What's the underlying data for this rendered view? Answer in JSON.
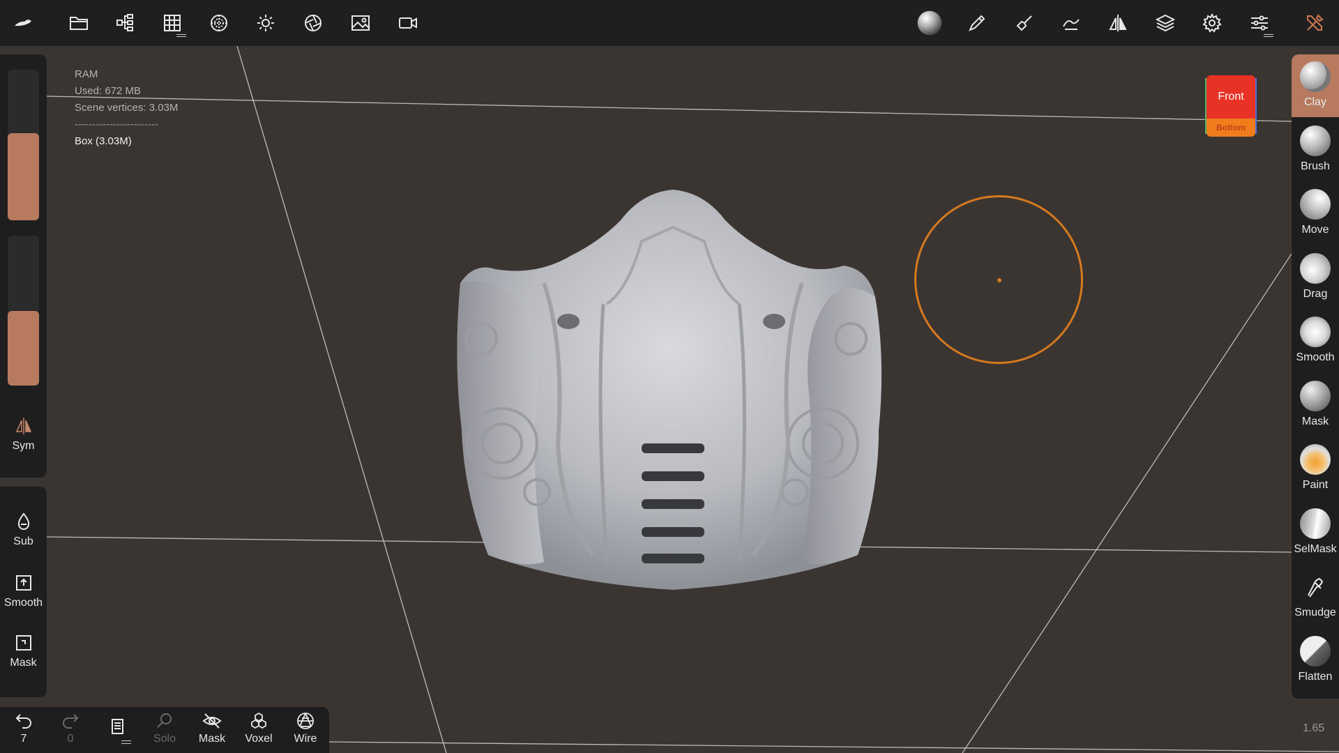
{
  "info": {
    "ram_label": "RAM",
    "used": "Used: 672 MB",
    "scene_vertices": "Scene vertices: 3.03M",
    "separator": "------------------------",
    "object": "Box (3.03M)"
  },
  "viewcube": {
    "front": "Front",
    "bottom": "Bottom"
  },
  "left_panel": {
    "sym_label": "Sym",
    "slider1_level": 0.58,
    "slider2_level": 0.5,
    "sub_label": "Sub",
    "smooth_label": "Smooth",
    "mask_label": "Mask"
  },
  "bottom_bar": {
    "undo_count": "7",
    "redo_count": "0",
    "solo_label": "Solo",
    "mask_label": "Mask",
    "voxel_label": "Voxel",
    "wire_label": "Wire"
  },
  "tools": {
    "clay": "Clay",
    "brush": "Brush",
    "move": "Move",
    "drag": "Drag",
    "smooth": "Smooth",
    "mask": "Mask",
    "paint": "Paint",
    "selmask": "SelMask",
    "smudge": "Smudge",
    "flatten": "Flatten"
  },
  "zoom_level": "1.65",
  "colors": {
    "accent": "#b77a5e",
    "brush_cursor": "#d77a1e",
    "viewport_bg": "#3b3532",
    "panel_bg": "#1e1e1f"
  }
}
